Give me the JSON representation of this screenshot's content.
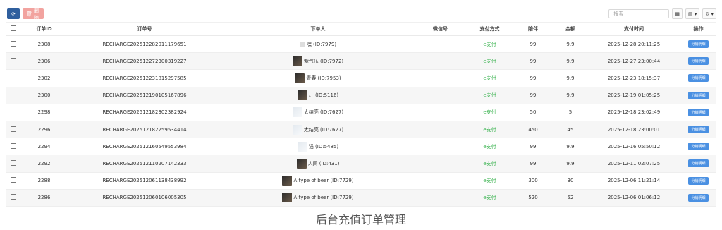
{
  "toolbar": {
    "refresh_icon": "refresh-icon",
    "delete_label": "删除",
    "search_placeholder": "搜索",
    "tools": [
      "▦",
      "▥ ▾",
      "⇩ ▾"
    ]
  },
  "table": {
    "headers": [
      "订单ID",
      "订单号",
      "下单人",
      "微信号",
      "支付方式",
      "陪伴",
      "金额",
      "支付时间",
      "操作"
    ],
    "rows": [
      {
        "id": "2308",
        "order": "RECHARGE202512282011179651",
        "avatar": "small",
        "user": "嘿 (ID:7979)",
        "wechat": "",
        "pay": "e支付",
        "qty": "99",
        "amount": "9.9",
        "time": "2025-12-28 20:11:25",
        "action": "分销明细"
      },
      {
        "id": "2306",
        "order": "RECHARGE202512272300319227",
        "avatar": "photo",
        "user": "紫气乐 (ID:7972)",
        "wechat": "",
        "pay": "e支付",
        "qty": "99",
        "amount": "9.9",
        "time": "2025-12-27 23:00:44",
        "action": "分销明细"
      },
      {
        "id": "2302",
        "order": "RECHARGE202512231815297585",
        "avatar": "photo",
        "user": "青春 (ID:7953)",
        "wechat": "",
        "pay": "e支付",
        "qty": "99",
        "amount": "9.9",
        "time": "2025-12-23 18:15:37",
        "action": "分销明细"
      },
      {
        "id": "2300",
        "order": "RECHARGE202512190105167896",
        "avatar": "photo",
        "user": "。 (ID:5116)",
        "wechat": "",
        "pay": "e支付",
        "qty": "99",
        "amount": "9.9",
        "time": "2025-12-19 01:05:25",
        "action": "分销明细"
      },
      {
        "id": "2298",
        "order": "RECHARGE202512182302382924",
        "avatar": "light",
        "user": "太结亮 (ID:7627)",
        "wechat": "",
        "pay": "e支付",
        "qty": "50",
        "amount": "5",
        "time": "2025-12-18 23:02:49",
        "action": "分销明细"
      },
      {
        "id": "2296",
        "order": "RECHARGE202512182259534414",
        "avatar": "light",
        "user": "太结亮 (ID:7627)",
        "wechat": "",
        "pay": "e支付",
        "qty": "450",
        "amount": "45",
        "time": "2025-12-18 23:00:01",
        "action": "分销明细"
      },
      {
        "id": "2294",
        "order": "RECHARGE202512160549553984",
        "avatar": "light",
        "user": "猫 (ID:5485)",
        "wechat": "",
        "pay": "e支付",
        "qty": "99",
        "amount": "9.9",
        "time": "2025-12-16 05:50:12",
        "action": "分销明细"
      },
      {
        "id": "2292",
        "order": "RECHARGE202512110207142333",
        "avatar": "photo",
        "user": "人间 (ID:431)",
        "wechat": "",
        "pay": "e支付",
        "qty": "99",
        "amount": "9.9",
        "time": "2025-12-11 02:07:25",
        "action": "分销明细"
      },
      {
        "id": "2288",
        "order": "RECHARGE202512061138438992",
        "avatar": "photo",
        "user": "A type of beer (ID:7729)",
        "wechat": "",
        "pay": "e支付",
        "qty": "300",
        "amount": "30",
        "time": "2025-12-06 11:21:14",
        "action": "分销明细"
      },
      {
        "id": "2286",
        "order": "RECHARGE202512060106005305",
        "avatar": "photo",
        "user": "A type of beer (ID:7729)",
        "wechat": "",
        "pay": "e支付",
        "qty": "520",
        "amount": "52",
        "time": "2025-12-06 01:06:12",
        "action": "分销明细"
      }
    ]
  },
  "caption": "后台充值订单管理"
}
